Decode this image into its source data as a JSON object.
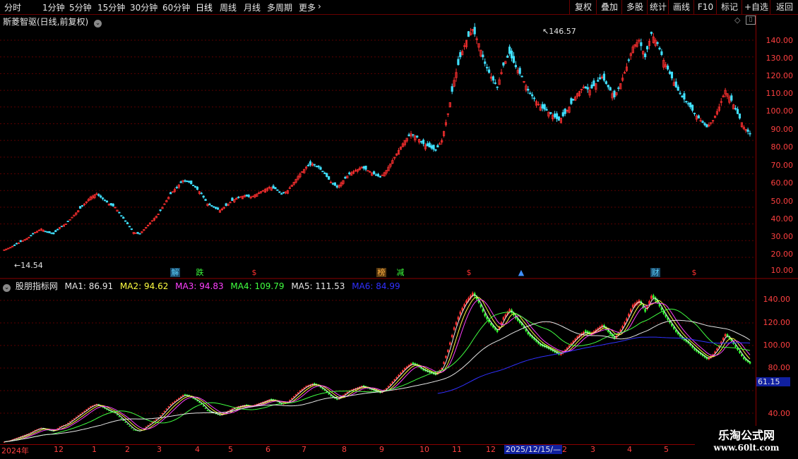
{
  "toolbar": {
    "periods": [
      "分时",
      "1分钟",
      "5分钟",
      "15分钟",
      "30分钟",
      "60分钟",
      "日线",
      "周线",
      "月线",
      "多周期",
      "更多"
    ],
    "active_period": "日线",
    "right_buttons": [
      "复权",
      "叠加",
      "多股",
      "统计",
      "画线",
      "F10",
      "标记",
      "+自选",
      "返回"
    ]
  },
  "main_chart": {
    "title": "斯菱智驱(日线,前复权)",
    "high_label": "146.57",
    "low_label": "14.54",
    "y_ticks": [
      "140.00",
      "130.00",
      "120.00",
      "110.00",
      "100.00",
      "90.00",
      "80.00",
      "70.00",
      "60.00",
      "50.00",
      "40.00",
      "30.00",
      "20.00",
      "10.00"
    ],
    "events": [
      {
        "label": "解",
        "color": "#5ad2ff"
      },
      {
        "label": "跌",
        "color": "#3cff3c"
      },
      {
        "label": "$",
        "color": "#ff3030"
      },
      {
        "label": "榜",
        "color": "#ffb040"
      },
      {
        "label": "减",
        "color": "#3cff3c"
      },
      {
        "label": "$",
        "color": "#ff3030"
      },
      {
        "label": "▲",
        "color": "#4090ff"
      },
      {
        "label": "财",
        "color": "#5ad2ff"
      },
      {
        "label": "$",
        "color": "#ff3030"
      }
    ]
  },
  "indicator": {
    "title": "股朋指标网",
    "ma": [
      {
        "name": "MA1",
        "value": "86.91",
        "color": "#e6e6e6"
      },
      {
        "name": "MA2",
        "value": "94.62",
        "color": "#ffff40"
      },
      {
        "name": "MA3",
        "value": "94.83",
        "color": "#ff40ff"
      },
      {
        "name": "MA4",
        "value": "109.79",
        "color": "#40ff40"
      },
      {
        "name": "MA5",
        "value": "111.53",
        "color": "#e6e6e6"
      },
      {
        "name": "MA6",
        "value": "84.99",
        "color": "#3030ff"
      }
    ],
    "y_ticks": [
      "140.00",
      "120.00",
      "100.00",
      "80.00",
      "40.00"
    ],
    "current_value": "61.15"
  },
  "time_axis": [
    "2024年",
    "12",
    "1",
    "2",
    "3",
    "4",
    "5",
    "6",
    "7",
    "8",
    "9",
    "10",
    "11",
    "12",
    "2025/12/15/—",
    "2",
    "3",
    "4",
    "5"
  ],
  "watermark": {
    "line1": "乐淘公式网",
    "line2": "www.60lt.com"
  },
  "chart_data": {
    "type": "candlestick",
    "title": "斯菱智驱(日线,前复权)",
    "series": [
      {
        "name": "price",
        "values": [
          14.54,
          16,
          18,
          20,
          22,
          25,
          27,
          25,
          24,
          28,
          30,
          34,
          38,
          42,
          46,
          48,
          45,
          42,
          40,
          35,
          30,
          25,
          24,
          28,
          32,
          36,
          42,
          48,
          52,
          56,
          55,
          52,
          48,
          42,
          40,
          38,
          41,
          44,
          46,
          47,
          46,
          48,
          50,
          52,
          51,
          48,
          50,
          55,
          60,
          64,
          66,
          64,
          60,
          55,
          52,
          56,
          60,
          62,
          64,
          62,
          60,
          58,
          62,
          68,
          74,
          80,
          84,
          82,
          78,
          76,
          74,
          80,
          96,
          116,
          130,
          140,
          146.57,
          138,
          126,
          118,
          112,
          125,
          132,
          124,
          118,
          110,
          105,
          100,
          98,
          95,
          92,
          96,
          102,
          108,
          112,
          110,
          114,
          118,
          112,
          106,
          114,
          124,
          136,
          140,
          130,
          144,
          138,
          128,
          120,
          112,
          106,
          102,
          96,
          92,
          88,
          92,
          100,
          110,
          104,
          96,
          88,
          84
        ]
      }
    ],
    "ylim": [
      10,
      146.57
    ]
  }
}
